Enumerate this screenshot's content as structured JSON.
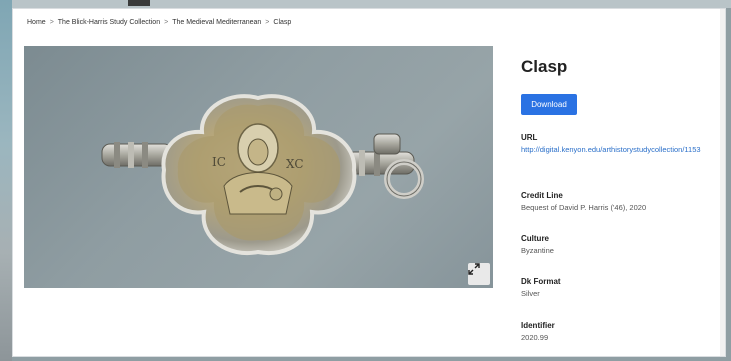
{
  "breadcrumb": {
    "items": [
      "Home",
      "The Blick-Harris Study Collection",
      "The Medieval Mediterranean",
      "Clasp"
    ],
    "separator": ">"
  },
  "item": {
    "title": "Clasp",
    "download_label": "Download"
  },
  "metadata": [
    {
      "label": "URL",
      "value": "http://digital.kenyon.edu/arthistorystudycollection/1153",
      "type": "link"
    },
    {
      "label": "Credit Line",
      "value": "Bequest of David P. Harris ('46), 2020",
      "type": "text"
    },
    {
      "label": "Culture",
      "value": "Byzantine",
      "type": "text"
    },
    {
      "label": "Dk Format",
      "value": "Silver",
      "type": "text"
    },
    {
      "label": "Identifier",
      "value": "2020.99",
      "type": "text"
    }
  ],
  "icons": {
    "expand": "expand-icon"
  },
  "colors": {
    "accent": "#2a72e3",
    "link": "#2a6fc9"
  }
}
